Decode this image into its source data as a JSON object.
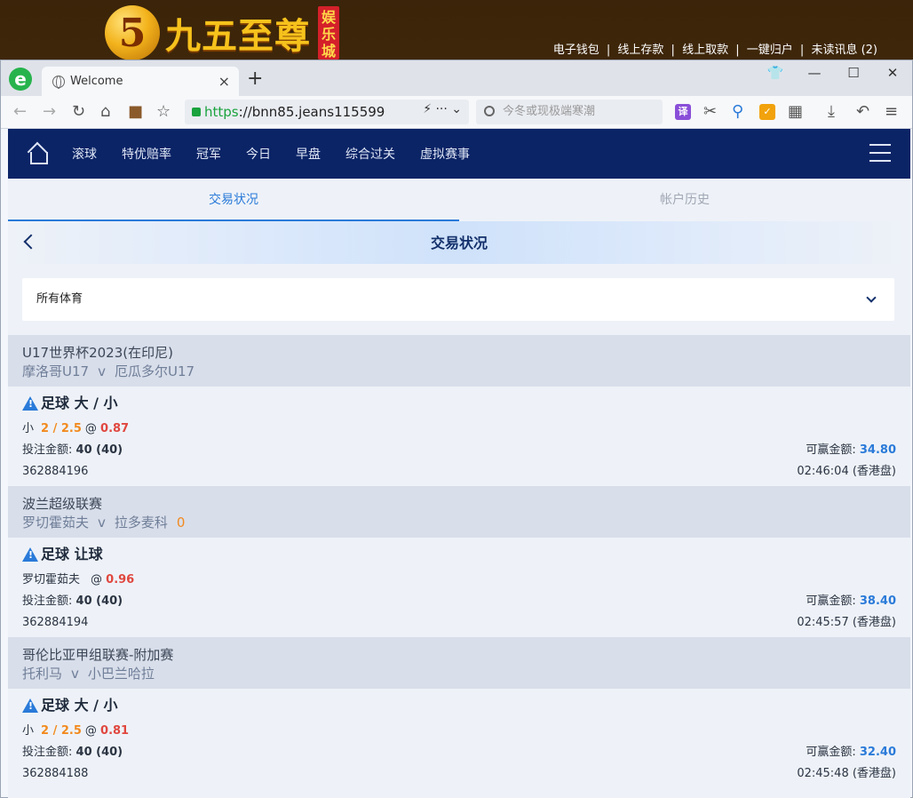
{
  "site": {
    "logo_glyph": "5",
    "brand": "九五至尊",
    "tag": "娱乐城",
    "links": [
      "电子钱包",
      "线上存款",
      "线上取款",
      "一键归户",
      "未读讯息 (2)"
    ],
    "separator": "|"
  },
  "browser": {
    "tab_title": "Welcome",
    "tab_close": "×",
    "new_tab": "+",
    "url_scheme": "https",
    "url_rest": "://bnn85.jeans115599",
    "url_tail": "⚡  ···  ⌄",
    "search_placeholder": "今冬或现极端寒潮",
    "ext_translate": "译",
    "window_buttons": [
      "👕",
      "—",
      "☐",
      "✕"
    ]
  },
  "nav": {
    "items": [
      "滚球",
      "特优赔率",
      "冠军",
      "今日",
      "早盘",
      "综合过关",
      "虚拟赛事"
    ]
  },
  "subtabs": {
    "active": "交易状况",
    "inactive": "帐户历史"
  },
  "page_title": "交易状况",
  "filter": {
    "selected": "所有体育"
  },
  "labels": {
    "stake": "投注金额:",
    "winnable": "可赢金额:",
    "v": "v",
    "at": "@"
  },
  "bets": [
    {
      "league": "U17世界杯2023(在印尼)",
      "home": "摩洛哥U17",
      "away": "厄瓜多尔U17",
      "score": "",
      "market": "足球 大 / 小",
      "selection": "小",
      "line": "2 / 2.5",
      "odds": "0.87",
      "stake": "40 (40)",
      "win": "34.80",
      "id": "362884196",
      "time": "02:46:04 (香港盘)"
    },
    {
      "league": "波兰超级联赛",
      "home": "罗切霍茹夫",
      "away": "拉多麦科",
      "score": "0",
      "market": "足球 让球",
      "selection": "罗切霍茹夫",
      "line": "",
      "odds": "0.96",
      "stake": "40 (40)",
      "win": "38.40",
      "id": "362884194",
      "time": "02:45:57 (香港盘)"
    },
    {
      "league": "哥伦比亚甲组联赛-附加赛",
      "home": "托利马",
      "away": "小巴兰哈拉",
      "score": "",
      "market": "足球 大 / 小",
      "selection": "小",
      "line": "2 / 2.5",
      "odds": "0.81",
      "stake": "40 (40)",
      "win": "32.40",
      "id": "362884188",
      "time": "02:45:48 (香港盘)"
    }
  ]
}
